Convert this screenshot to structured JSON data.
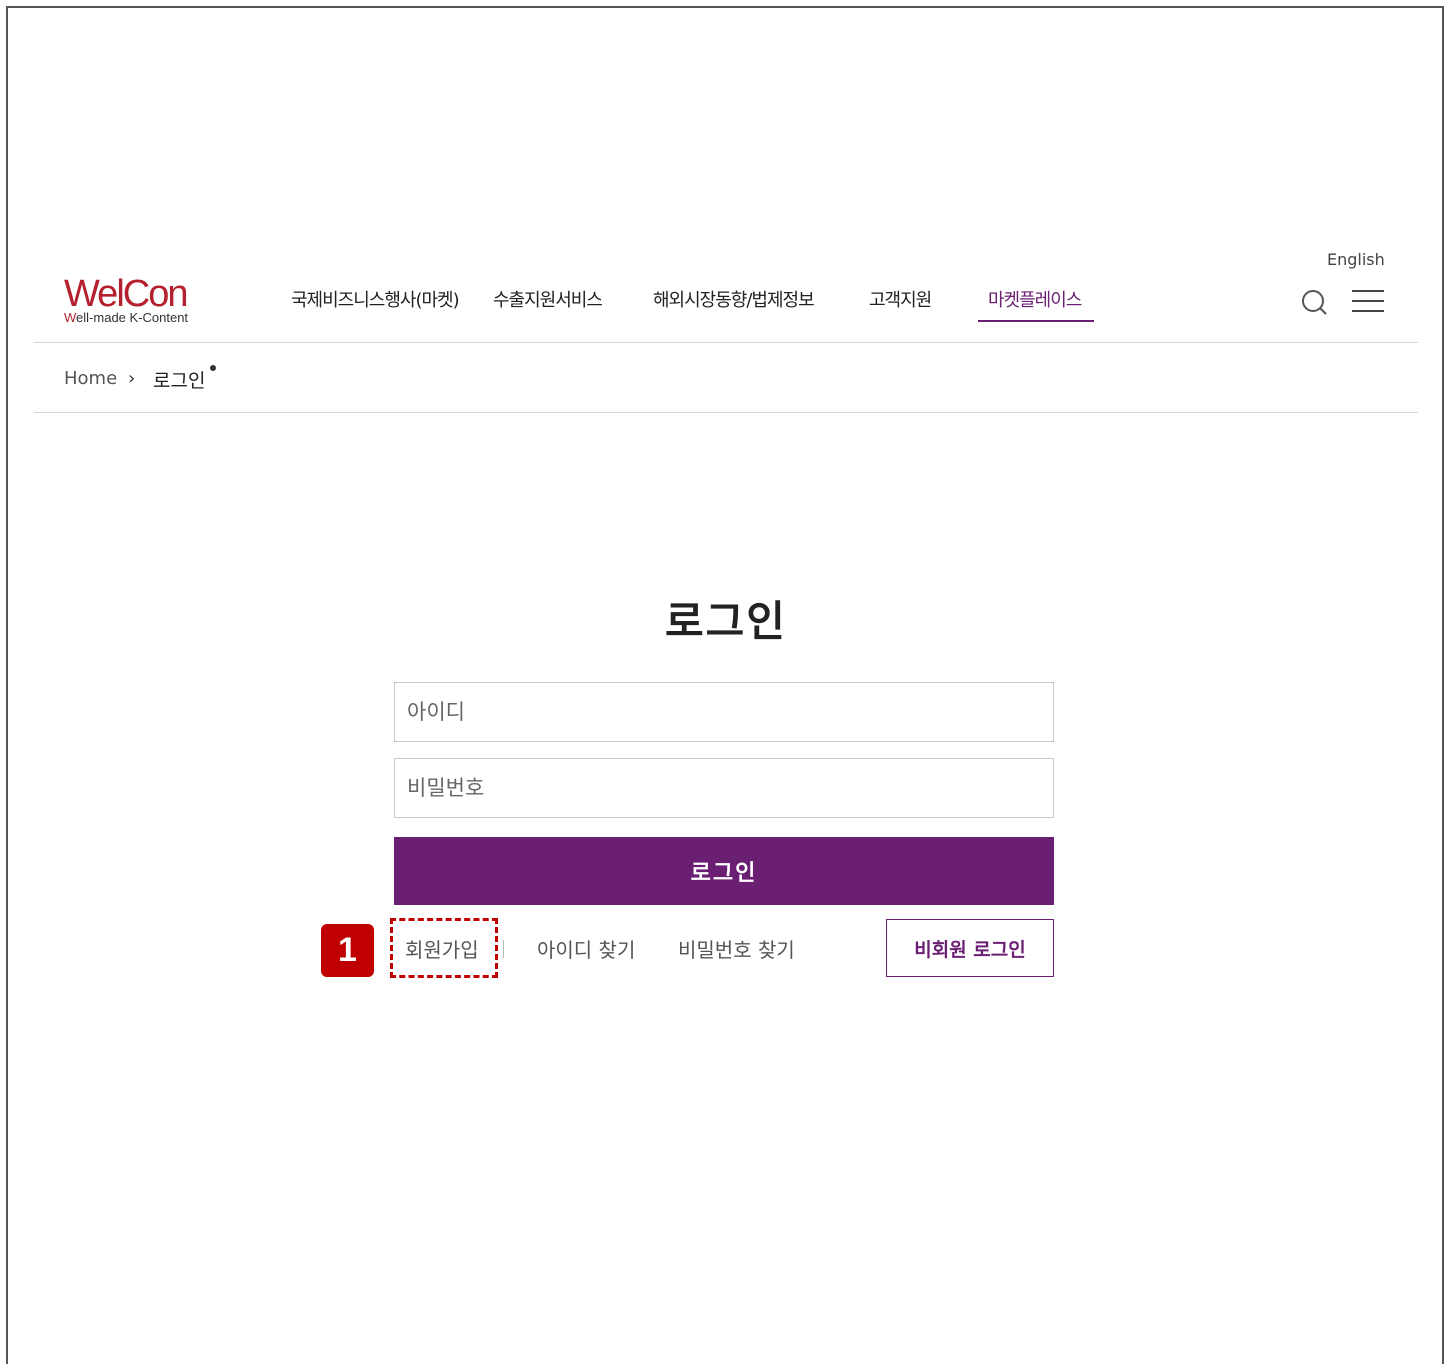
{
  "header": {
    "language_link": "English",
    "logo": {
      "main_text": "WelCon",
      "tagline_w": "W",
      "tagline_rest": "ell-made K-Content"
    },
    "nav": [
      {
        "label": "국제비즈니스행사(마켓)",
        "active": false
      },
      {
        "label": "수출지원서비스",
        "active": false
      },
      {
        "label": "해외시장동향/법제정보",
        "active": false
      },
      {
        "label": "고객지원",
        "active": false
      },
      {
        "label": "마켓플레이스",
        "active": true
      }
    ],
    "icons": [
      "search-icon",
      "hamburger-menu-icon"
    ]
  },
  "breadcrumb": {
    "home": "Home",
    "separator": "›",
    "current": "로그인"
  },
  "login": {
    "title": "로그인",
    "id_placeholder": "아이디",
    "pw_placeholder": "비밀번호",
    "submit_label": "로그인",
    "signup_link": "회원가입",
    "find_id_link": "아이디 찾기",
    "find_pw_link": "비밀번호 찾기",
    "guest_login_label": "비회원 로그인"
  },
  "annotation": {
    "step_number": "1"
  },
  "colors": {
    "brand_purple": "#6b1f73",
    "logo_red": "#b5202e",
    "annotation_red": "#c00000"
  }
}
